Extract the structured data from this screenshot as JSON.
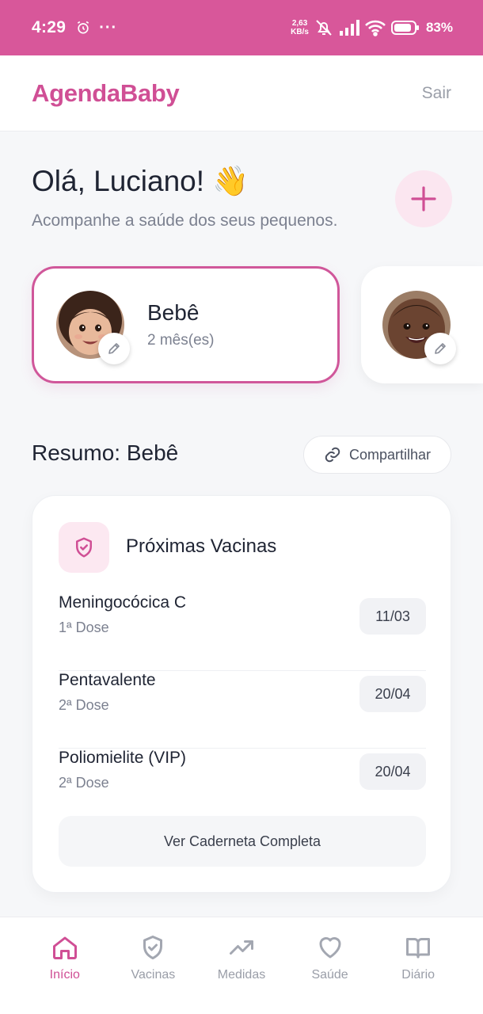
{
  "status_bar": {
    "time": "4:29",
    "dots": "···",
    "speed_value": "2,63",
    "speed_unit": "KB/s",
    "battery": "83%"
  },
  "app": {
    "brand": "AgendaBaby",
    "logout_label": "Sair",
    "brand_color": "#d04f95"
  },
  "greeting": {
    "title": "Olá, Luciano! 👋",
    "subtitle": "Acompanhe a saúde dos seus pequenos.",
    "add_icon": "plus-icon"
  },
  "babies": [
    {
      "name": "Bebê",
      "age": "2 mês(es)",
      "selected": true
    },
    {
      "name": "",
      "age": "",
      "selected": false
    }
  ],
  "summary": {
    "title": "Resumo: Bebê",
    "share_label": "Compartilhar"
  },
  "vaccines": {
    "title": "Próximas Vacinas",
    "items": [
      {
        "name": "Meningocócica C",
        "dose": "1ª Dose",
        "date": "11/03"
      },
      {
        "name": "Pentavalente",
        "dose": "2ª Dose",
        "date": "20/04"
      },
      {
        "name": "Poliomielite (VIP)",
        "dose": "2ª Dose",
        "date": "20/04"
      }
    ],
    "full_button_label": "Ver Caderneta Completa"
  },
  "nav": {
    "items": [
      {
        "label": "Início",
        "icon": "home-icon",
        "active": true
      },
      {
        "label": "Vacinas",
        "icon": "shield-check-icon",
        "active": false
      },
      {
        "label": "Medidas",
        "icon": "trending-up-icon",
        "active": false
      },
      {
        "label": "Saúde",
        "icon": "heart-icon",
        "active": false
      },
      {
        "label": "Diário",
        "icon": "book-icon",
        "active": false
      }
    ]
  }
}
